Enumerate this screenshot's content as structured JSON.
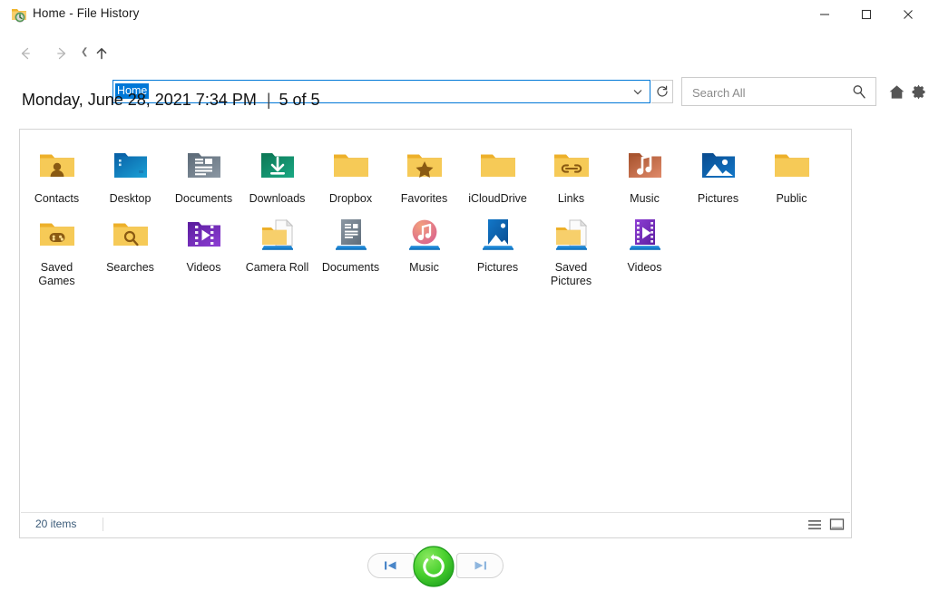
{
  "window": {
    "title": "Home - File History",
    "icon": "folder-history-icon",
    "minimize_label": "─",
    "maximize_label": "□",
    "close_label": "✕"
  },
  "toolbar": {
    "back_icon": "arrow-left-icon",
    "forward_icon": "arrow-right-icon",
    "recent_icon": "recent-locations-icon",
    "up_icon": "arrow-up-icon",
    "address_value": "Home",
    "address_dropdown_icon": "chevron-down-icon",
    "refresh_icon": "refresh-icon",
    "search_placeholder": "Search All",
    "search_value": "",
    "search_icon": "search-icon",
    "home_icon": "home-icon",
    "settings_icon": "gear-icon"
  },
  "header": {
    "date": "Monday, June 28, 2021 7:34 PM",
    "separator": "|",
    "count": "5 of 5"
  },
  "status": {
    "items_count": "20 items",
    "details_view_icon": "details-view-icon",
    "icons_view_icon": "large-icons-view-icon"
  },
  "transport": {
    "previous_label": "⏮",
    "restore_label": "restore-icon",
    "next_label": "⏭"
  },
  "colors": {
    "accent": "#0078d7",
    "restore_green": "#2fb72b",
    "folder_yellow": "#f7c955",
    "status_text": "#3a5a78"
  },
  "items": [
    {
      "label": "Contacts",
      "icon": "folder-contacts-icon",
      "type": "folder-badge",
      "badge": "person",
      "color": "#f5c243"
    },
    {
      "label": "Desktop",
      "icon": "folder-desktop-icon",
      "type": "folder-image",
      "badge": "desktop",
      "color": "#1ba1d6"
    },
    {
      "label": "Documents",
      "icon": "folder-documents-icon",
      "type": "folder-image",
      "badge": "doc",
      "color": "#8b97a3"
    },
    {
      "label": "Downloads",
      "icon": "folder-downloads-icon",
      "type": "folder-image",
      "badge": "download",
      "color": "#1aa883"
    },
    {
      "label": "Dropbox",
      "icon": "folder-dropbox-icon",
      "type": "folder-plain",
      "badge": "",
      "color": "#f5c243"
    },
    {
      "label": "Favorites",
      "icon": "folder-favorites-icon",
      "type": "folder-badge",
      "badge": "star",
      "color": "#f5c243"
    },
    {
      "label": "iCloudDrive",
      "icon": "folder-iclouddrive-icon",
      "type": "folder-plain",
      "badge": "",
      "color": "#f5c243"
    },
    {
      "label": "Links",
      "icon": "folder-links-icon",
      "type": "folder-badge",
      "badge": "link",
      "color": "#f5c243"
    },
    {
      "label": "Music",
      "icon": "folder-music-icon",
      "type": "folder-image",
      "badge": "note",
      "color": "#e08a6a"
    },
    {
      "label": "Pictures",
      "icon": "folder-pictures-icon",
      "type": "folder-image",
      "badge": "picture",
      "color": "#1277c8"
    },
    {
      "label": "Public",
      "icon": "folder-public-icon",
      "type": "folder-plain",
      "badge": "",
      "color": "#f5c243"
    },
    {
      "label": "Saved Games",
      "icon": "folder-saved-games-icon",
      "type": "folder-badge",
      "badge": "gamepad",
      "color": "#f5c243"
    },
    {
      "label": "Searches",
      "icon": "folder-searches-icon",
      "type": "folder-badge",
      "badge": "search",
      "color": "#f5c243"
    },
    {
      "label": "Videos",
      "icon": "folder-videos-icon",
      "type": "folder-image",
      "badge": "film",
      "color": "#8e3fd4"
    },
    {
      "label": "Camera Roll",
      "icon": "library-camera-roll-icon",
      "type": "library-folder",
      "badge": "",
      "color": "#f5c243"
    },
    {
      "label": "Documents",
      "icon": "library-documents-icon",
      "type": "library",
      "badge": "doc",
      "color": "#8b97a3"
    },
    {
      "label": "Music",
      "icon": "library-music-icon",
      "type": "library-circle",
      "badge": "note",
      "color": "#e4806a"
    },
    {
      "label": "Pictures",
      "icon": "library-pictures-icon",
      "type": "library",
      "badge": "picture",
      "color": "#1277c8"
    },
    {
      "label": "Saved Pictures",
      "icon": "library-saved-pictures-icon",
      "type": "library-folder",
      "badge": "",
      "color": "#f5c243"
    },
    {
      "label": "Videos",
      "icon": "library-videos-icon",
      "type": "library",
      "badge": "film",
      "color": "#8e3fd4"
    }
  ]
}
